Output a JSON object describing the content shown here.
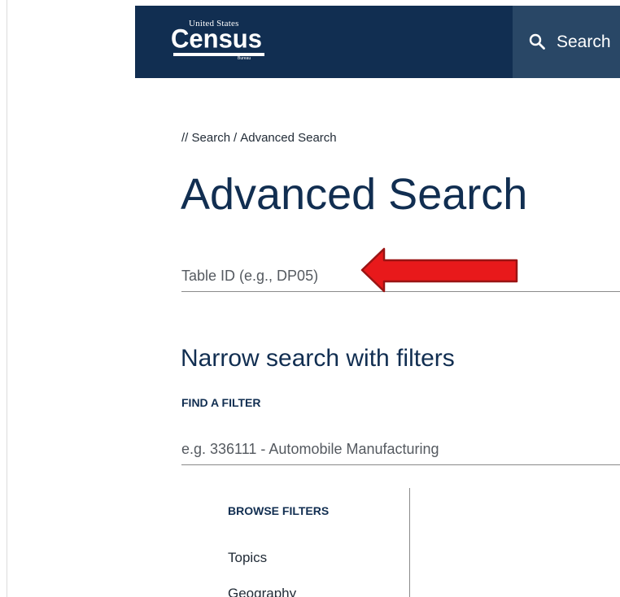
{
  "header": {
    "logo": {
      "small_text": "United States",
      "main_text": "Census",
      "bureau_text": "Bureau"
    },
    "search_nav_label": "Search",
    "search_icon": "search-icon",
    "background_color": "#112e51",
    "search_background_color": "#294766"
  },
  "breadcrumb": {
    "prefix": "//",
    "items": [
      "Search",
      "Advanced Search"
    ],
    "separator": "/"
  },
  "page_title": "Advanced Search",
  "table_id_input": {
    "placeholder": "Table ID (e.g., DP05)",
    "value": ""
  },
  "annotation": {
    "icon": "red-arrow-pointing-left",
    "color": "#e8191b"
  },
  "filters": {
    "heading": "Narrow search with filters",
    "find_label": "FIND A FILTER",
    "input_placeholder": "e.g. 336111 - Automobile Manufacturing",
    "input_value": "",
    "browse_label": "BROWSE FILTERS",
    "browse_items": [
      "Topics",
      "Geography"
    ]
  }
}
